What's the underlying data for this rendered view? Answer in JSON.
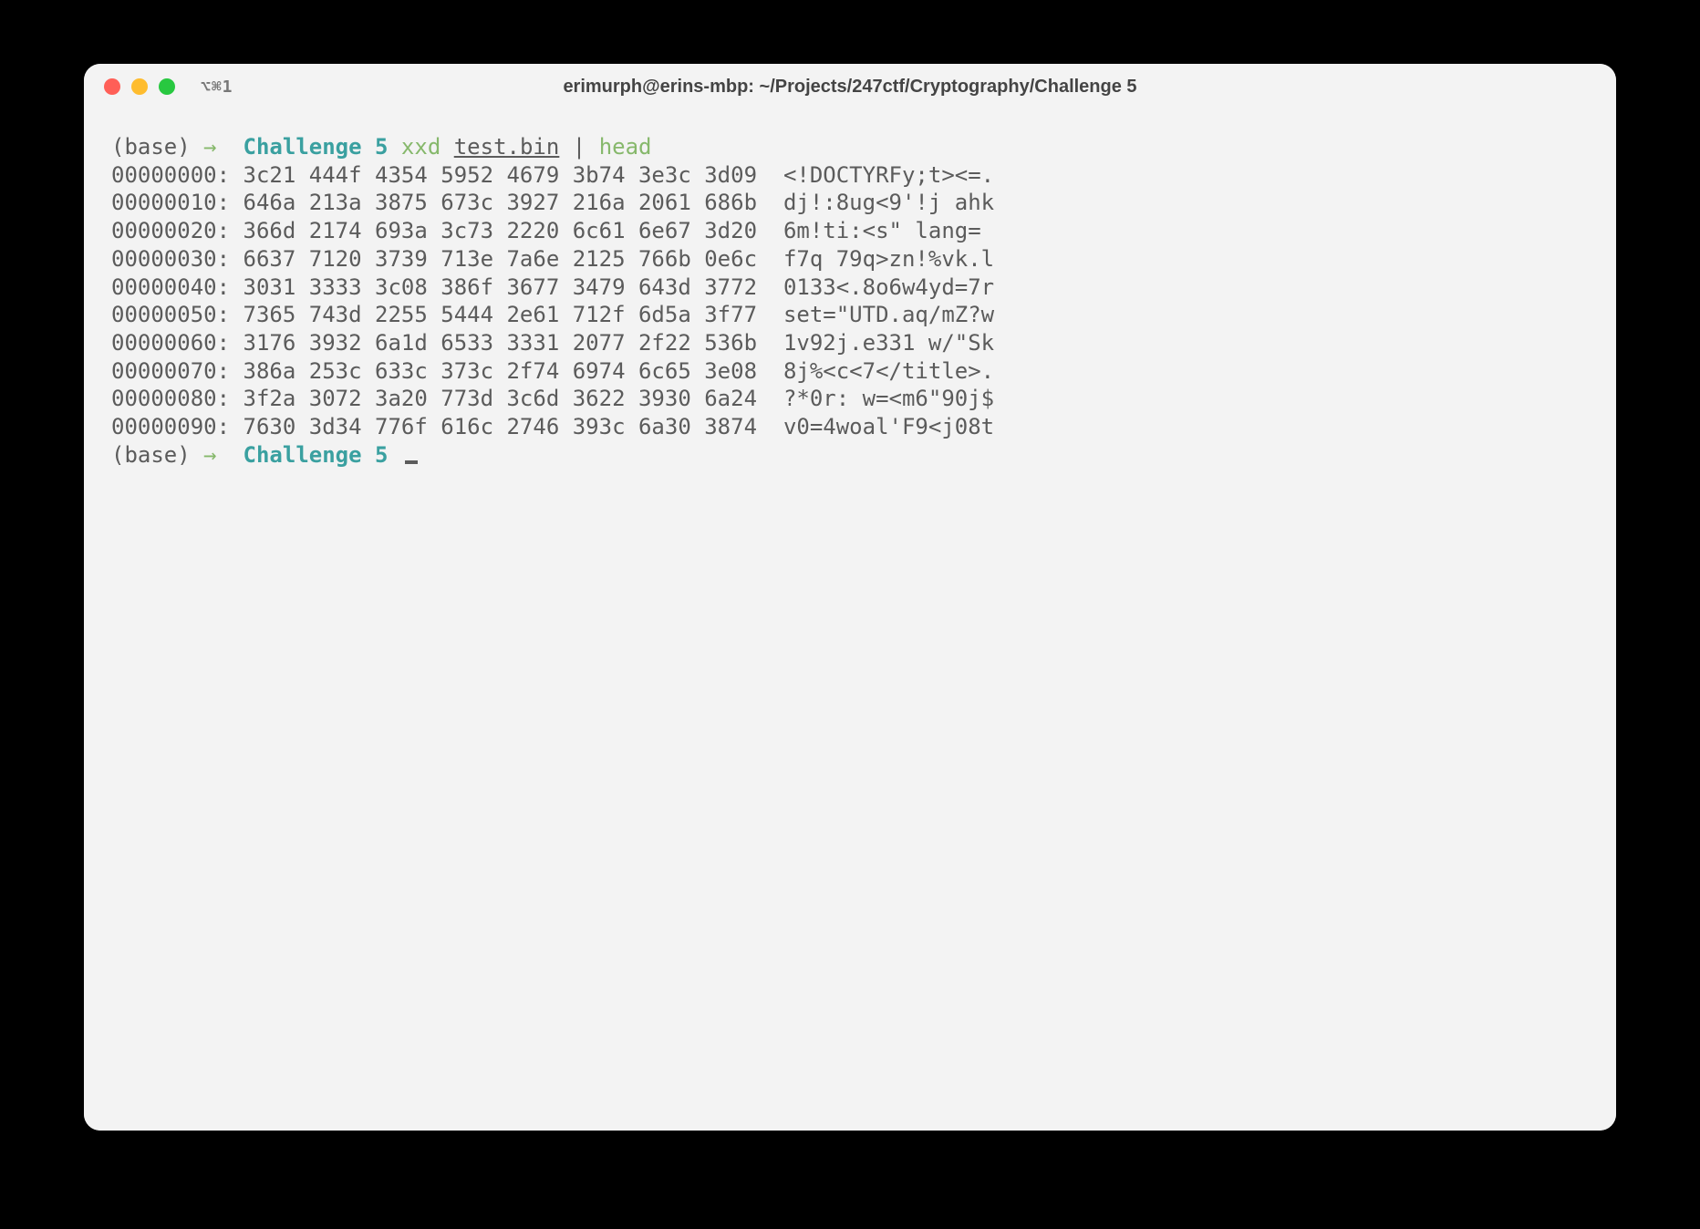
{
  "titlebar": {
    "tab_indicator": "⌥⌘1",
    "title": "erimurph@erins-mbp: ~/Projects/247ctf/Cryptography/Challenge 5"
  },
  "prompt": {
    "base": "(base)",
    "arrow": "→",
    "dir": "Challenge 5"
  },
  "command1": {
    "exec1": "xxd",
    "arg1": "test.bin",
    "pipe": "|",
    "exec2": "head"
  },
  "hexdump": [
    {
      "offset": "00000000:",
      "bytes": "3c21 444f 4354 5952 4679 3b74 3e3c 3d09",
      "ascii": "<!DOCTYRFy;t><=."
    },
    {
      "offset": "00000010:",
      "bytes": "646a 213a 3875 673c 3927 216a 2061 686b",
      "ascii": "dj!:8ug<9'!j ahk"
    },
    {
      "offset": "00000020:",
      "bytes": "366d 2174 693a 3c73 2220 6c61 6e67 3d20",
      "ascii": "6m!ti:<s\" lang= "
    },
    {
      "offset": "00000030:",
      "bytes": "6637 7120 3739 713e 7a6e 2125 766b 0e6c",
      "ascii": "f7q 79q>zn!%vk.l"
    },
    {
      "offset": "00000040:",
      "bytes": "3031 3333 3c08 386f 3677 3479 643d 3772",
      "ascii": "0133<.8o6w4yd=7r"
    },
    {
      "offset": "00000050:",
      "bytes": "7365 743d 2255 5444 2e61 712f 6d5a 3f77",
      "ascii": "set=\"UTD.aq/mZ?w"
    },
    {
      "offset": "00000060:",
      "bytes": "3176 3932 6a1d 6533 3331 2077 2f22 536b",
      "ascii": "1v92j.e331 w/\"Sk"
    },
    {
      "offset": "00000070:",
      "bytes": "386a 253c 633c 373c 2f74 6974 6c65 3e08",
      "ascii": "8j%<c<7</title>."
    },
    {
      "offset": "00000080:",
      "bytes": "3f2a 3072 3a20 773d 3c6d 3622 3930 6a24",
      "ascii": "?*0r: w=<m6\"90j$"
    },
    {
      "offset": "00000090:",
      "bytes": "7630 3d34 776f 616c 2746 393c 6a30 3874",
      "ascii": "v0=4woal'F9<j08t"
    }
  ]
}
